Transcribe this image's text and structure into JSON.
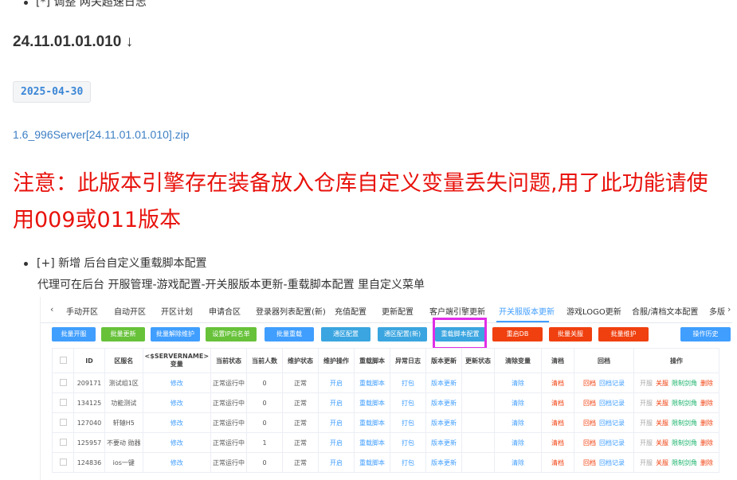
{
  "top_bullet": "[*] 调整 网关超速日志",
  "version_heading": "24.11.01.01.010 ↓",
  "date_badge": "2025-04-30",
  "zip_link": "1.6_996Server[24.11.01.01.010].zip",
  "notice": "注意：此版本引擎存在装备放入仓库自定义变量丢失问题,用了此功能请使用009或011版本",
  "feature_line": "[+] 新增 后台自定义重载脚本配置",
  "description": "代理可在后台 开服管理-游戏配置-开关服版本更新-重载脚本配置 里自定义菜单",
  "screenshot": {
    "tabs": [
      "手动开区",
      "自动开区",
      "开区计划",
      "申请合区",
      "登录器列表配置(新)",
      "充值配置",
      "更新配置",
      "客户端引擎更新",
      "开关服版本更新",
      "游戏LOGO更新",
      "合服/清档文本配置",
      "多版"
    ],
    "active_tab": "开关服版本更新",
    "arrow_left": "‹",
    "arrow_right": "›",
    "buttons": [
      "批量开服",
      "批量更新",
      "批量解除维护",
      "设置IP白名单",
      "批量重载",
      "通区配置",
      "通区配置(新)",
      "重载脚本配置",
      "重启DB",
      "批量关服",
      "批量维护",
      "操作历史"
    ],
    "table_headers": [
      "",
      "ID",
      "区服名",
      "<$SERVERNAME>\n变量",
      "当前状态",
      "当前人数",
      "维护状态",
      "维护操作",
      "重载脚本",
      "异常日志",
      "版本更新",
      "更新状态",
      "清除变量",
      "清档",
      "回档",
      "操作"
    ],
    "rows": [
      {
        "id": "209171",
        "name": "测试组1区",
        "var": "修改",
        "status": "正常运行中",
        "players": "0",
        "maint": "正常",
        "op": "开启",
        "reload": "重载脚本",
        "log": "打包",
        "update": "版本更新",
        "ustatus": "",
        "clear": "清除",
        "wipe": "清档",
        "rollback": "回档",
        "rollback2": "回档记录",
        "ops": [
          "开服",
          "关服",
          "限制剑角",
          "删除"
        ]
      },
      {
        "id": "134125",
        "name": "功能测试",
        "var": "修改",
        "status": "正常运行中",
        "players": "0",
        "maint": "正常",
        "op": "开启",
        "reload": "重载脚本",
        "log": "打包",
        "update": "版本更新",
        "ustatus": "",
        "clear": "清除",
        "wipe": "清档",
        "rollback": "回档",
        "rollback2": "回档记录",
        "ops": [
          "开服",
          "关服",
          "限制剑角",
          "删除"
        ]
      },
      {
        "id": "127040",
        "name": "轩辕H5",
        "var": "修改",
        "status": "正常运行中",
        "players": "0",
        "maint": "正常",
        "op": "开启",
        "reload": "重载脚本",
        "log": "打包",
        "update": "版本更新",
        "ustatus": "",
        "clear": "清除",
        "wipe": "清档",
        "rollback": "回档",
        "rollback2": "回档记录",
        "ops": [
          "开服",
          "关服",
          "限制剑角",
          "删除"
        ]
      },
      {
        "id": "125957",
        "name": "不要动 勋器",
        "var": "修改",
        "status": "正常运行中",
        "players": "1",
        "maint": "正常",
        "op": "开启",
        "reload": "重载脚本",
        "log": "打包",
        "update": "版本更新",
        "ustatus": "",
        "clear": "清除",
        "wipe": "清档",
        "rollback": "回档",
        "rollback2": "回档记录",
        "ops": [
          "开服",
          "关服",
          "限制剑角",
          "删除"
        ]
      },
      {
        "id": "124836",
        "name": "ios一键",
        "var": "修改",
        "status": "正常运行中",
        "players": "0",
        "maint": "正常",
        "op": "开启",
        "reload": "重载脚本",
        "log": "打包",
        "update": "版本更新",
        "ustatus": "",
        "clear": "清除",
        "wipe": "清档",
        "rollback": "回档",
        "rollback2": "回档记录",
        "ops": [
          "开服",
          "关服",
          "限制剑角",
          "删除"
        ]
      }
    ]
  }
}
